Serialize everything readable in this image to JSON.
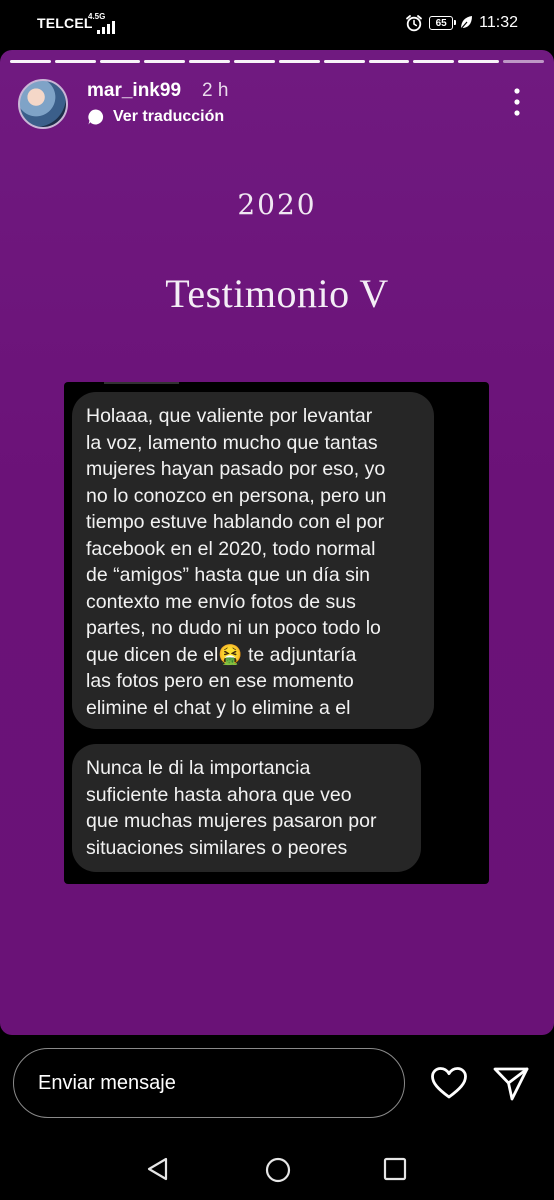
{
  "status_bar": {
    "carrier": "TELCEL",
    "network": "4.5G",
    "battery": "65",
    "time": "11:32",
    "icons": [
      "signal-icon",
      "alarm-icon",
      "battery-icon",
      "leaf-icon"
    ]
  },
  "story": {
    "progress_segments": 12,
    "current_segment": 12,
    "username": "mar_ink99",
    "time_ago": "2 h",
    "translate_label": "Ver traducción",
    "year": "2020",
    "title": "Testimonio V",
    "background_color": "#6b1278",
    "bubble_color": "#262626",
    "messages": [
      {
        "lines": [
          "Holaaa, que valiente por levantar",
          "la voz, lamento mucho que tantas",
          "mujeres hayan pasado por eso, yo",
          "no lo conozco en persona, pero un",
          "tiempo estuve hablando con el por",
          "facebook en el 2020, todo normal",
          "de “amigos” hasta que un día sin",
          "contexto me envío fotos de sus",
          "partes, no dudo ni un poco todo lo",
          "que dicen de el🤮  te adjuntaría",
          "las fotos pero en ese momento",
          "elimine el chat y lo elimine a el"
        ]
      },
      {
        "lines": [
          "Nunca le di la importancia",
          "suficiente hasta ahora que veo",
          "que muchas mujeres pasaron por",
          "situaciones similares o peores"
        ]
      }
    ]
  },
  "reply_bar": {
    "placeholder": "Enviar mensaje"
  }
}
